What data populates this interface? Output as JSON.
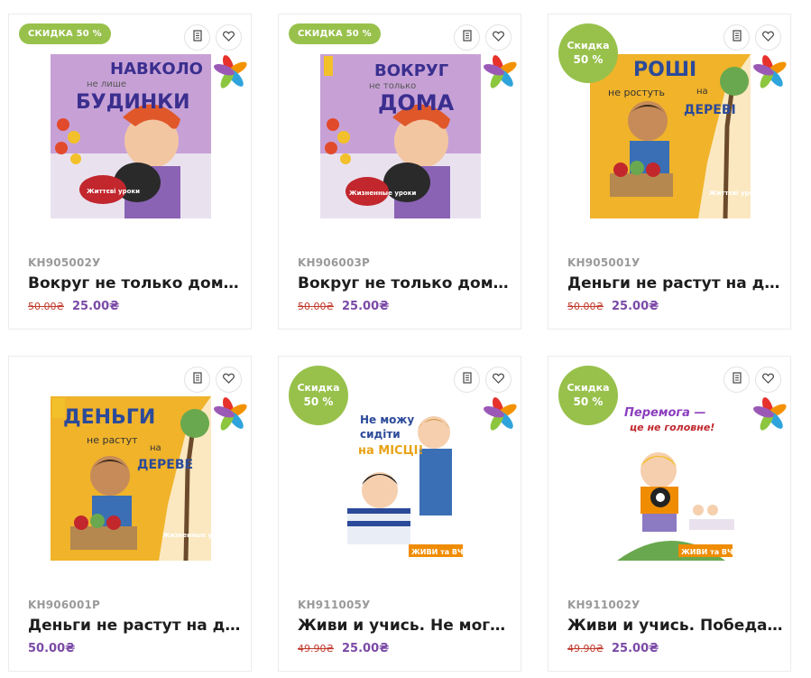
{
  "colors": {
    "badge": "#98c14c",
    "price": "#7b4aa6",
    "old_price": "#c0392b",
    "sku": "#9a9a9a"
  },
  "icons": {
    "compare": "document-list-icon",
    "wishlist": "heart-icon",
    "brand": "colorful-hands-logo"
  },
  "products": [
    {
      "badge": "СКИДКА 50 %",
      "badge_style": "pill",
      "sku": "KH905002У",
      "name": "Вокруг не только дома...",
      "old_price": "50.00₴",
      "price": "25.00₴",
      "cover": {
        "bg": "#c7a1d6",
        "t1": "НАВКОЛО",
        "t2": "не лише",
        "t3": "БУДИНКИ",
        "series": "Життєві уроки"
      }
    },
    {
      "badge": "СКИДКА 50 %",
      "badge_style": "pill",
      "sku": "KH906003Р",
      "name": "Вокруг не только дома...",
      "old_price": "50.00₴",
      "price": "25.00₴",
      "cover": {
        "bg": "#c7a1d6",
        "t1": "ВОКРУГ",
        "t2": "не только",
        "t3": "ДОМА",
        "series": "Жизненные уроки"
      }
    },
    {
      "badge_l1": "Скидка",
      "badge_l2": "50 %",
      "badge_style": "circle",
      "sku": "KH905001У",
      "name": "Деньги не растут на де...",
      "old_price": "50.00₴",
      "price": "25.00₴",
      "cover": {
        "bg": "#f0b32a",
        "t1": "ГРОШІ",
        "t2": "не ростуть",
        "t3": "на ДЕРЕВІ",
        "series": "Життєві уроки"
      }
    },
    {
      "badge_style": "none",
      "sku": "KH906001Р",
      "name": "Деньги не растут на де...",
      "old_price": "",
      "price": "50.00₴",
      "cover": {
        "bg": "#f0b32a",
        "t1": "ДЕНЬГИ",
        "t2": "не растут",
        "t3": "на ДЕРЕВЕ",
        "series": "Жизненные уроки"
      }
    },
    {
      "badge_l1": "Скидка",
      "badge_l2": "50 %",
      "badge_style": "circle",
      "sku": "KH911005У",
      "name": "Живи и учись. Не могу ...",
      "old_price": "49.90₴",
      "price": "25.00₴",
      "cover": {
        "bg": "#ffffff",
        "t1": "Не можу",
        "t2": "сидіти",
        "t3": "на МІСЦІ!",
        "series": "ЖИВИ та ВЧИСЬ"
      }
    },
    {
      "badge_l1": "Скидка",
      "badge_l2": "50 %",
      "badge_style": "circle",
      "sku": "KH911002У",
      "name": "Живи и учись. Победа-...",
      "old_price": "49.90₴",
      "price": "25.00₴",
      "cover": {
        "bg": "#ffffff",
        "t1": "Перемога —",
        "t2": "це не головне!",
        "t3": "",
        "series": "ЖИВИ та ВЧИСЬ"
      }
    }
  ]
}
